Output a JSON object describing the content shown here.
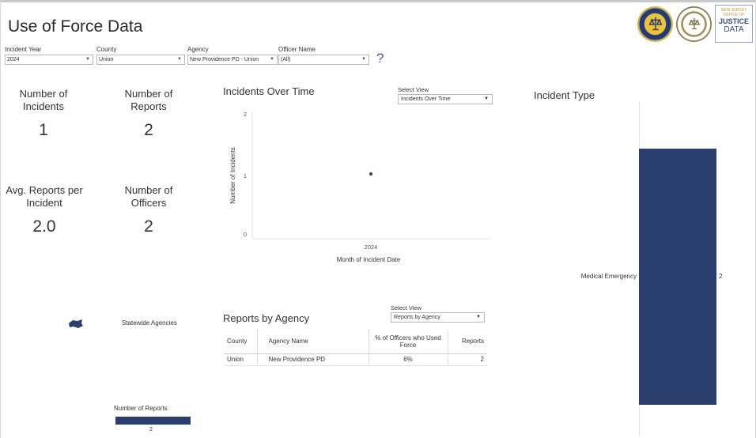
{
  "header": {
    "title": "Use of Force Data"
  },
  "filters": [
    {
      "label": "Incident Year",
      "value": "2024"
    },
    {
      "label": "County",
      "value": "Union"
    },
    {
      "label": "Agency",
      "value": "New Providence PD - Union"
    },
    {
      "label": "Officer Name",
      "value": "(All)"
    }
  ],
  "help_symbol": "?",
  "logos": {
    "nj_text_1": "NEW JERSEY",
    "nj_text_2": "OFFICE OF",
    "nj_text_3": "JUSTICE",
    "nj_text_4": "DATA"
  },
  "kpis": {
    "incidents": {
      "label": "Number of Incidents",
      "value": "1"
    },
    "reports": {
      "label": "Number of Reports",
      "value": "2"
    },
    "avg_reports": {
      "label": "Avg. Reports per Incident",
      "value": "2.0"
    },
    "officers": {
      "label": "Number of Officers",
      "value": "2"
    }
  },
  "incidents_over_time": {
    "title": "Incidents Over Time",
    "select_view_label": "Select View",
    "select_view_value": "Incidents Over Time",
    "chart_data": {
      "type": "scatter",
      "x": [
        "2024"
      ],
      "y": [
        1
      ],
      "xlabel": "Month of Incident Date",
      "ylabel": "Number of Incidents",
      "ylim": [
        0,
        2
      ],
      "yticks": [
        "0",
        "1",
        "2"
      ],
      "grid": false
    }
  },
  "map": {
    "statewide_label": "Statewide Agencies",
    "legend_title": "Number of Reports",
    "legend_value": "2"
  },
  "reports_by_agency": {
    "title": "Reports by Agency",
    "select_view_label": "Select View",
    "select_view_value": "Reports by Agency",
    "columns": [
      "County",
      "Agency Name",
      "% of Officers who Used Force",
      "Reports"
    ],
    "rows": [
      [
        "Union",
        "New Providence PD",
        "6%",
        "2"
      ]
    ]
  },
  "incident_type": {
    "title": "Incident Type",
    "chart_data": {
      "type": "bar",
      "orientation": "horizontal",
      "categories": [
        "Medical Emergency"
      ],
      "values": [
        2
      ]
    }
  },
  "colors": {
    "bar": "#2b3f6e",
    "accent": "#3b5fa3"
  }
}
